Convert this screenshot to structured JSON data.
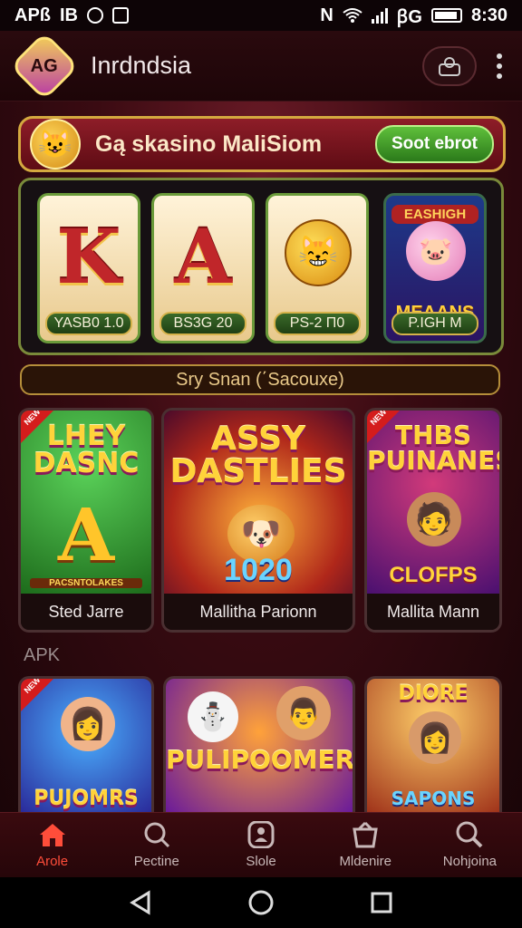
{
  "status_bar": {
    "left_text": "APß",
    "left_text2": "IB",
    "network": "N",
    "extra": "ꞵG",
    "time": "8:30"
  },
  "header": {
    "title": "Inrdndsia"
  },
  "promo": {
    "text": "Gą skasino MaliSiom",
    "button": "Soot ebrot"
  },
  "reels": [
    {
      "symbol": "K",
      "bet": "YASB0 1.0"
    },
    {
      "symbol": "A",
      "bet": "BS3G 20"
    },
    {
      "symbol": "",
      "bet": "PS-2 Π0"
    },
    {
      "symbol": "",
      "top_label": "EASHIGH",
      "caption": "MEAANS",
      "bet": "P.IGH M"
    }
  ],
  "spin_bar": {
    "text": "Sry Snan (΄Sacouxe)"
  },
  "games_row1": [
    {
      "title_lines": [
        "LHEY",
        "DASNC"
      ],
      "big_symbol": "A",
      "sub": "PACSNTOLAKES",
      "label": "Sted Jarre",
      "tag": "NEW"
    },
    {
      "title_lines": [
        "ASSY",
        "DASTLIES"
      ],
      "sub": "1020",
      "label": "Mallitha Parionn"
    },
    {
      "title_lines": [
        "THBS",
        "PUINANES"
      ],
      "sub": "CLOFPS",
      "label": "Mallita Mann",
      "tag": "NEW"
    }
  ],
  "section_label": "APK",
  "games_row2": [
    {
      "title_lines": [
        "PUJOMRS"
      ],
      "tag": "NEW"
    },
    {
      "title_lines": [
        "PULIPOOMERS"
      ]
    },
    {
      "title_lines": [
        "DIORE",
        "SAPONS"
      ]
    }
  ],
  "bottom_nav": [
    {
      "label": "Arole",
      "icon": "home-icon",
      "active": true
    },
    {
      "label": "Pectine",
      "icon": "search-refresh-icon"
    },
    {
      "label": "Slole",
      "icon": "user-icon"
    },
    {
      "label": "Mldenire",
      "icon": "bucket-icon"
    },
    {
      "label": "Nohjoina",
      "icon": "search-icon"
    }
  ],
  "colors": {
    "accent": "#ff4d3a",
    "gold": "#d4a93f",
    "background": "#1a0608"
  }
}
